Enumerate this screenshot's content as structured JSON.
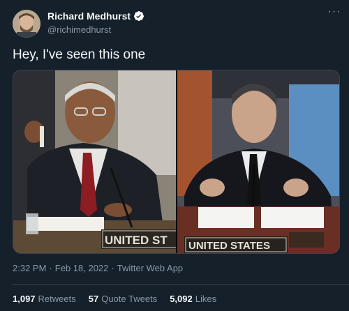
{
  "user": {
    "display_name": "Richard Medhurst",
    "handle": "@richimedhurst",
    "verified_icon": "verified-badge-icon"
  },
  "tweet": {
    "text": "Hey, I've seen this one",
    "time": "2:32 PM",
    "date": "Feb 18, 2022",
    "source": "Twitter Web App",
    "separator": "·"
  },
  "media": {
    "left_sign": "UNITED ST",
    "right_sign": "UNITED STATES"
  },
  "stats": {
    "retweets_count": "1,097",
    "retweets_label": "Retweets",
    "quotes_count": "57",
    "quotes_label": "Quote Tweets",
    "likes_count": "5,092",
    "likes_label": "Likes"
  },
  "colors": {
    "background": "#15202b",
    "secondary_text": "#8b98a5",
    "divider": "#38444d",
    "verified": "#ffffff"
  }
}
